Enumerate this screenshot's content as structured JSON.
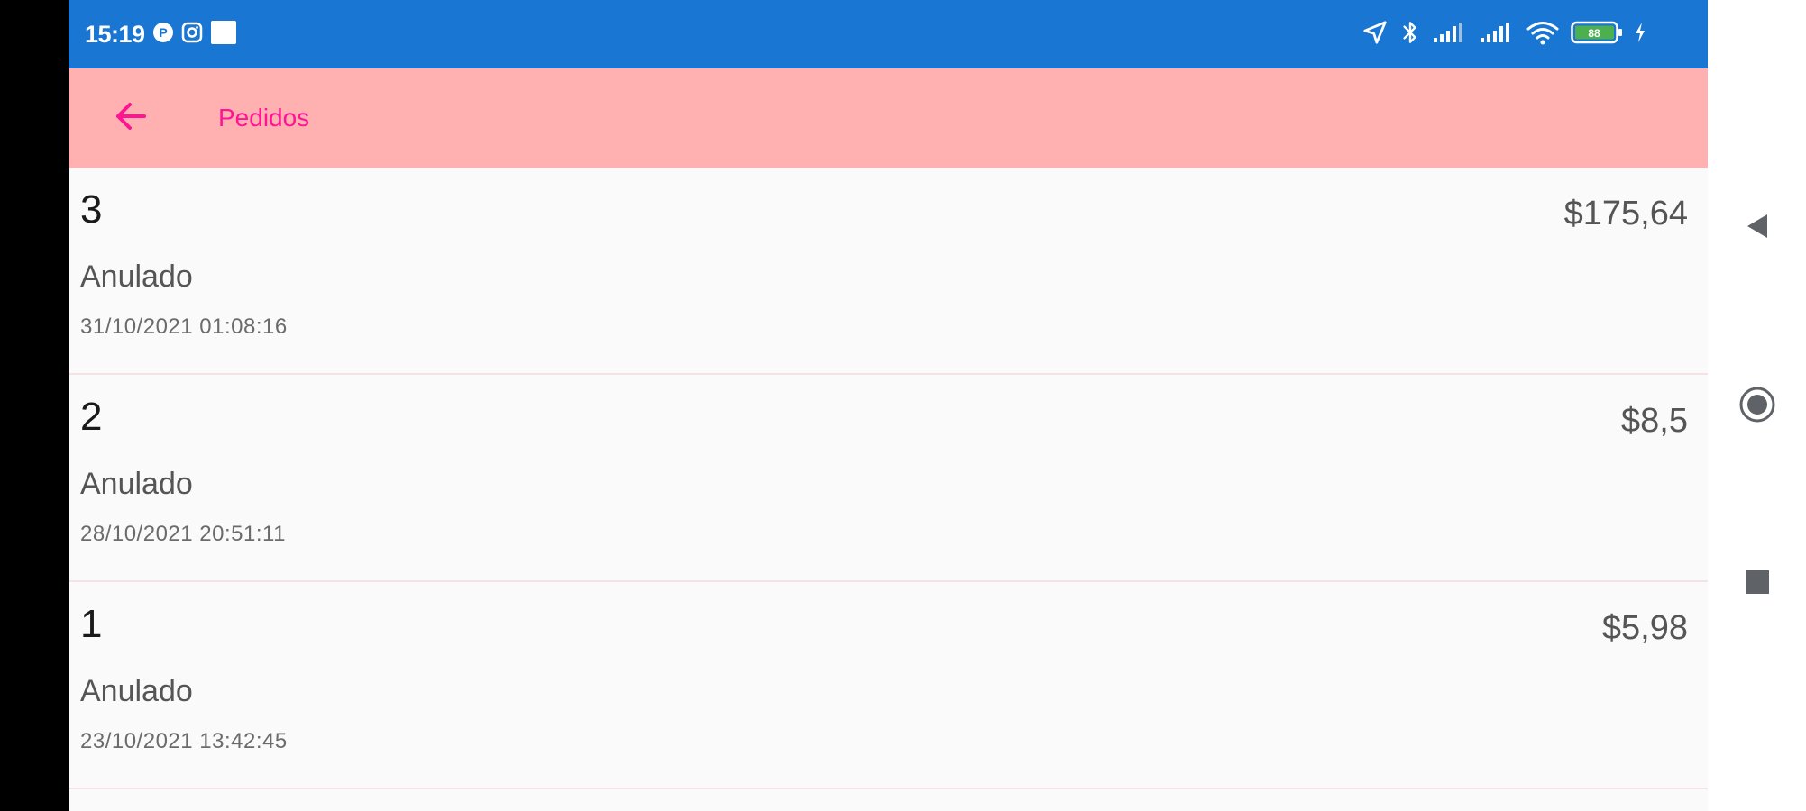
{
  "status_bar": {
    "time": "15:19",
    "left_icons": [
      "parking-app-icon",
      "instagram-icon",
      "image-notification-icon"
    ],
    "right_icons": [
      "location-icon",
      "bluetooth-icon",
      "signal-icon",
      "signal-icon",
      "wifi-icon",
      "battery-icon",
      "charging-icon"
    ],
    "battery_level": "88",
    "background_color": "#1976d2"
  },
  "app_bar": {
    "title": "Pedidos",
    "back_icon": "arrow-left-icon",
    "background_color": "#ffb1b1",
    "accent_color": "#ff1493"
  },
  "orders": [
    {
      "number": "3",
      "status": "Anulado",
      "date": "31/10/2021 01:08:16",
      "amount": "$175,64"
    },
    {
      "number": "2",
      "status": "Anulado",
      "date": "28/10/2021 20:51:11",
      "amount": "$8,5"
    },
    {
      "number": "1",
      "status": "Anulado",
      "date": "23/10/2021 13:42:45",
      "amount": "$5,98"
    }
  ],
  "nav_bar": {
    "buttons": [
      "back-triangle-icon",
      "home-circle-icon",
      "recents-square-icon"
    ]
  }
}
